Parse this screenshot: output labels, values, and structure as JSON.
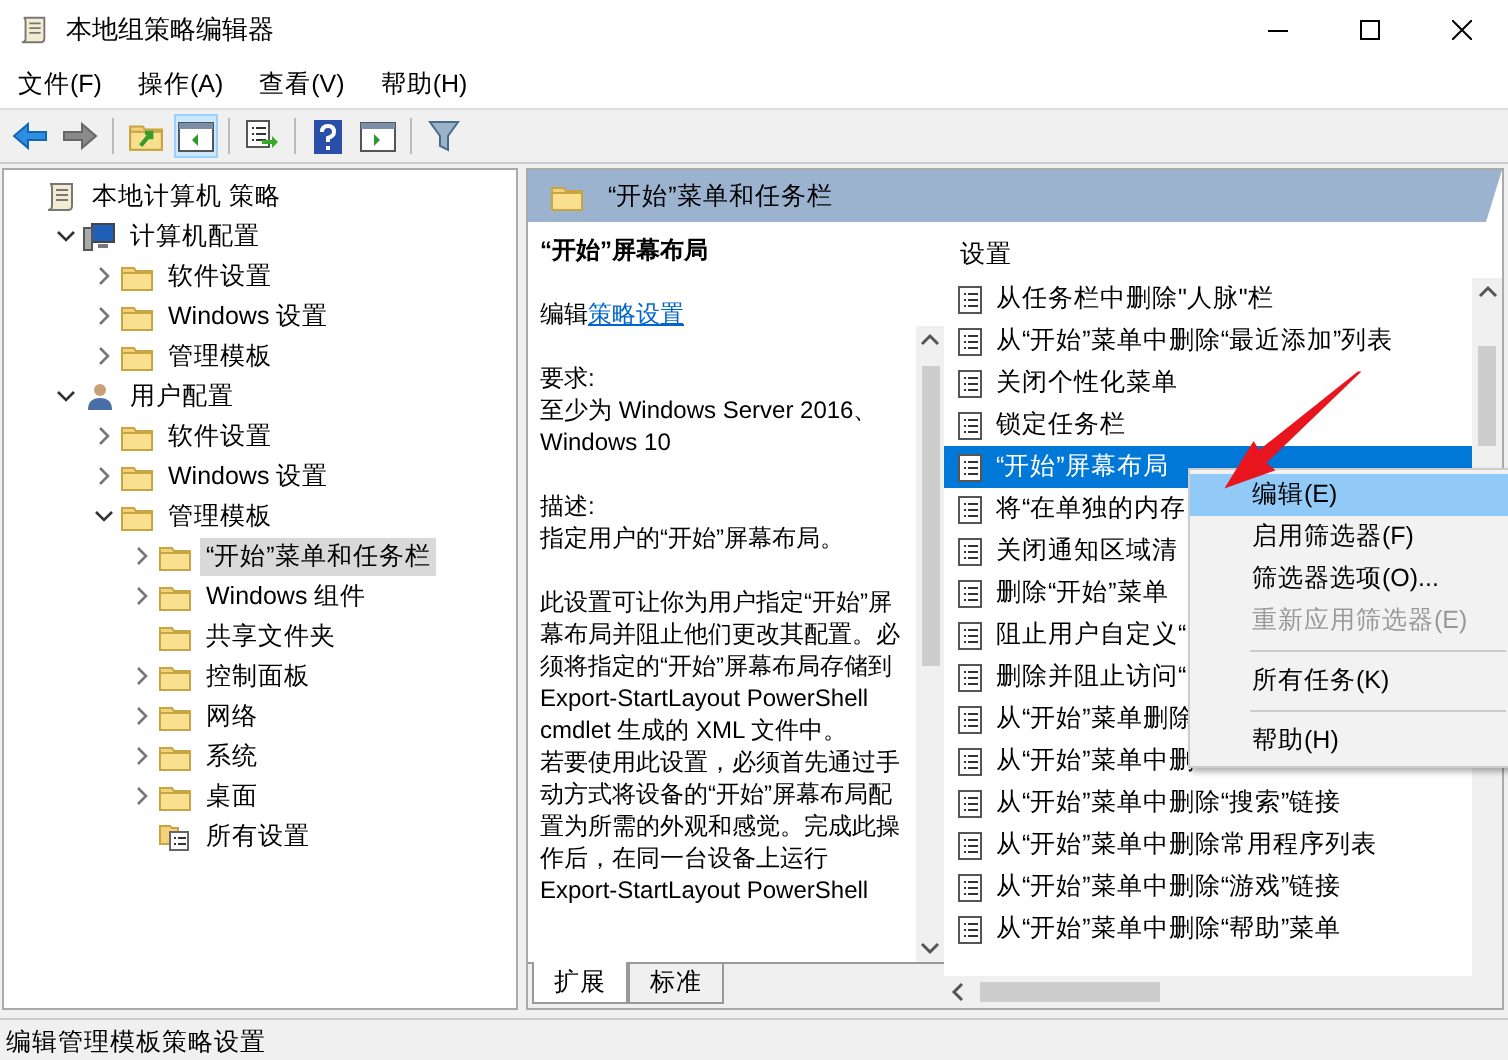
{
  "window": {
    "title": "本地组策略编辑器"
  },
  "menu": [
    "文件(F)",
    "操作(A)",
    "查看(V)",
    "帮助(H)"
  ],
  "toolbar": [
    {
      "kind": "back",
      "pressed": false
    },
    {
      "kind": "forward",
      "pressed": false
    },
    {
      "kind": "sep"
    },
    {
      "kind": "up",
      "pressed": false
    },
    {
      "kind": "tree",
      "pressed": true
    },
    {
      "kind": "sep"
    },
    {
      "kind": "export",
      "pressed": false
    },
    {
      "kind": "sep"
    },
    {
      "kind": "help",
      "pressed": false
    },
    {
      "kind": "pane",
      "pressed": false
    },
    {
      "kind": "sep"
    },
    {
      "kind": "filter",
      "pressed": false
    }
  ],
  "tree": [
    {
      "label": "本地计算机 策略",
      "kind": "policy",
      "expandable": false,
      "selected": false,
      "children": [
        {
          "label": "计算机配置",
          "kind": "computer",
          "expandable": true,
          "expanded": true,
          "selected": false,
          "children": [
            {
              "label": "软件设置",
              "kind": "folder",
              "expandable": true,
              "expanded": false,
              "selected": false
            },
            {
              "label": "Windows 设置",
              "kind": "folder",
              "expandable": true,
              "expanded": false,
              "selected": false
            },
            {
              "label": "管理模板",
              "kind": "folder",
              "expandable": true,
              "expanded": false,
              "selected": false
            }
          ]
        },
        {
          "label": "用户配置",
          "kind": "user",
          "expandable": true,
          "expanded": true,
          "selected": false,
          "children": [
            {
              "label": "软件设置",
              "kind": "folder",
              "expandable": true,
              "expanded": false,
              "selected": false
            },
            {
              "label": "Windows 设置",
              "kind": "folder",
              "expandable": true,
              "expanded": false,
              "selected": false
            },
            {
              "label": "管理模板",
              "kind": "folder",
              "expandable": true,
              "expanded": true,
              "selected": false,
              "children": [
                {
                  "label": "“开始”菜单和任务栏",
                  "kind": "folder",
                  "expandable": true,
                  "expanded": false,
                  "selected": true
                },
                {
                  "label": "Windows 组件",
                  "kind": "folder",
                  "expandable": true,
                  "expanded": false,
                  "selected": false
                },
                {
                  "label": "共享文件夹",
                  "kind": "folder",
                  "expandable": false,
                  "selected": false
                },
                {
                  "label": "控制面板",
                  "kind": "folder",
                  "expandable": true,
                  "expanded": false,
                  "selected": false
                },
                {
                  "label": "网络",
                  "kind": "folder",
                  "expandable": true,
                  "expanded": false,
                  "selected": false
                },
                {
                  "label": "系统",
                  "kind": "folder",
                  "expandable": true,
                  "expanded": false,
                  "selected": false
                },
                {
                  "label": "桌面",
                  "kind": "folder",
                  "expandable": true,
                  "expanded": false,
                  "selected": false
                },
                {
                  "label": "所有设置",
                  "kind": "settings",
                  "expandable": false,
                  "selected": false
                }
              ]
            }
          ]
        }
      ]
    }
  ],
  "header": {
    "title": "“开始”菜单和任务栏"
  },
  "description": {
    "title": "“开始”屏幕布局",
    "edit_prefix": "编辑",
    "edit_link": "策略设置",
    "requirements_label": "要求:",
    "requirements": "至少为 Windows Server 2016、Windows 10",
    "description_label": "描述:",
    "summary": "指定用户的“开始”屏幕布局。",
    "body": [
      "此设置可让你为用户指定“开始”屏幕布局并阻止他们更改其配置。必须将指定的“开始”屏幕布局存储到 Export-StartLayout PowerShell cmdlet 生成的 XML 文件中。",
      "若要使用此设置，必须首先通过手动方式将设备的“开始”屏幕布局配置为所需的外观和感觉。完成此操作后，在同一台设备上运行 Export-StartLayout PowerShell"
    ]
  },
  "view_tabs": [
    {
      "label": "扩展",
      "selected": true
    },
    {
      "label": "标准",
      "selected": false
    }
  ],
  "settings": {
    "column": "设置",
    "rows": [
      {
        "label": "从任务栏中删除\"人脉\"栏",
        "selected": false
      },
      {
        "label": "从“开始”菜单中删除“最近添加”列表",
        "selected": false
      },
      {
        "label": "关闭个性化菜单",
        "selected": false
      },
      {
        "label": "锁定任务栏",
        "selected": false
      },
      {
        "label": "“开始”屏幕布局",
        "selected": true
      },
      {
        "label": "将“在单独的内存",
        "selected": false
      },
      {
        "label": "关闭通知区域清",
        "selected": false
      },
      {
        "label": "删除“开始”菜单",
        "selected": false
      },
      {
        "label": "阻止用户自定义“",
        "selected": false
      },
      {
        "label": "删除并阻止访问“",
        "selected": false
      },
      {
        "label": "从“开始”菜单删除",
        "selected": false
      },
      {
        "label": "从“开始”菜单中删",
        "selected": false
      },
      {
        "label": "从“开始”菜单中删除“搜索”链接",
        "selected": false
      },
      {
        "label": "从“开始”菜单中删除常用程序列表",
        "selected": false
      },
      {
        "label": "从“开始”菜单中删除“游戏”链接",
        "selected": false
      },
      {
        "label": "从“开始”菜单中删除“帮助”菜单",
        "selected": false
      }
    ]
  },
  "context_menu": [
    {
      "kind": "item",
      "label": "编辑(E)",
      "selected": true,
      "disabled": false
    },
    {
      "kind": "item",
      "label": "启用筛选器(F)",
      "selected": false,
      "disabled": false
    },
    {
      "kind": "item",
      "label": "筛选器选项(O)...",
      "selected": false,
      "disabled": false
    },
    {
      "kind": "item",
      "label": "重新应用筛选器(E)",
      "selected": false,
      "disabled": true
    },
    {
      "kind": "separator"
    },
    {
      "kind": "item",
      "label": "所有任务(K)",
      "selected": false,
      "disabled": false
    },
    {
      "kind": "separator"
    },
    {
      "kind": "item",
      "label": "帮助(H)",
      "selected": false,
      "disabled": false
    }
  ],
  "status_bar": "编辑管理模板策略设置"
}
